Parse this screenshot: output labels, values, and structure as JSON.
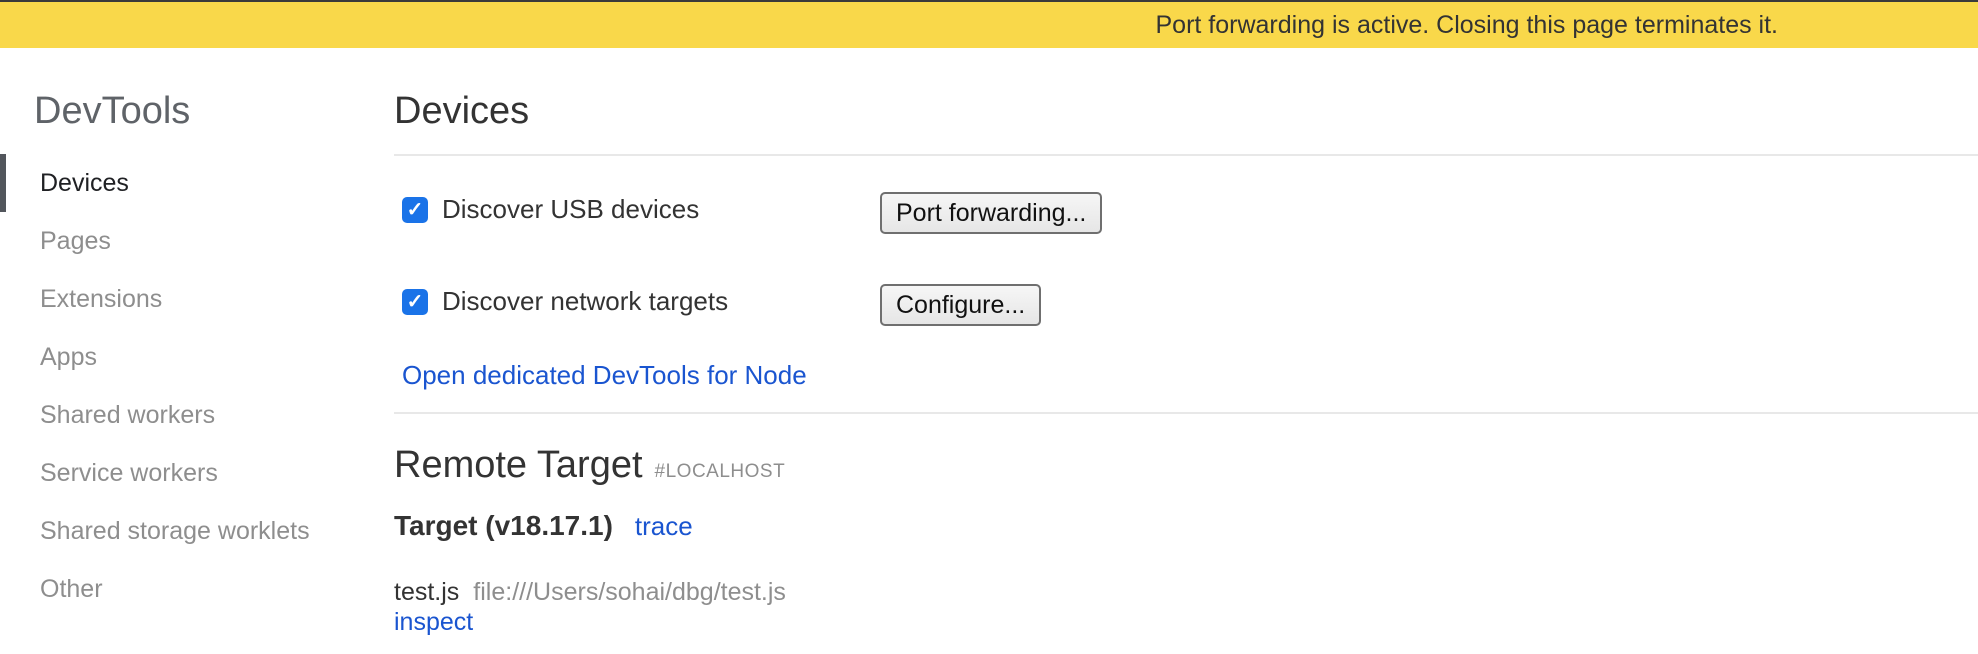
{
  "banner": {
    "text": "Port forwarding is active. Closing this page terminates it."
  },
  "sidebar": {
    "title": "DevTools",
    "items": [
      {
        "label": "Devices",
        "active": true
      },
      {
        "label": "Pages"
      },
      {
        "label": "Extensions"
      },
      {
        "label": "Apps"
      },
      {
        "label": "Shared workers"
      },
      {
        "label": "Service workers"
      },
      {
        "label": "Shared storage worklets"
      },
      {
        "label": "Other"
      }
    ]
  },
  "main": {
    "title": "Devices",
    "usb": {
      "label": "Discover USB devices",
      "checked": true,
      "button": "Port forwarding..."
    },
    "network": {
      "label": "Discover network targets",
      "checked": true,
      "button": "Configure..."
    },
    "node_link": "Open dedicated DevTools for Node",
    "remote": {
      "title": "Remote Target",
      "subtitle": "#LOCALHOST",
      "target_name": "Target (v18.17.1)",
      "trace_link": "trace",
      "file_name": "test.js",
      "file_path": "file:///Users/sohai/dbg/test.js",
      "inspect_link": "inspect"
    }
  },
  "colors": {
    "banner": "#f9d84a",
    "link": "#1a55d0",
    "checkbox": "#1a73e8"
  }
}
